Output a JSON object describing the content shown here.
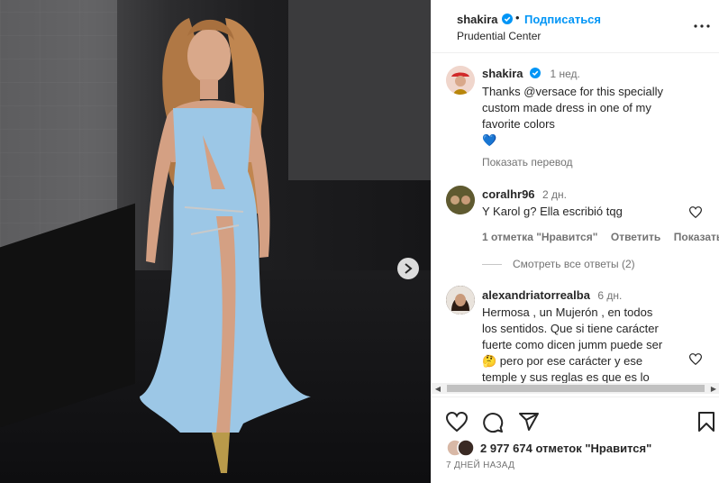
{
  "post": {
    "username": "shakira",
    "follow_label": "Подписаться",
    "dot": "•",
    "location": "Prudential Center"
  },
  "caption": {
    "username": "shakira",
    "time": "1 нед.",
    "text_line1": "Thanks @versace for this specially",
    "text_line2": "custom made dress in one of my",
    "text_line3": "favorite colors",
    "text_line4": "💙",
    "translate_label": "Показать перевод"
  },
  "comments": [
    {
      "username": "coralhr96",
      "time": "2 дн.",
      "text": "Y Karol g? Ella escribió tqg",
      "likes": "1 отметка \"Нравится\"",
      "reply": "Ответить",
      "translate": "Показать п",
      "view_replies": "Смотреть все ответы (2)"
    },
    {
      "username": "alexandriatorrealba",
      "time": "6 дн.",
      "line1": "Hermosa , un Mujerón , en todos",
      "line2": "los sentidos. Que si tiene carácter",
      "line3": "fuerte como dicen jumm puede ser",
      "line4": "🤔 pero por ese carácter y ese",
      "line5": "temple y sus reglas es que es lo"
    }
  ],
  "likes_count": "2 977 674 отметок \"Нравится\"",
  "date": "7 ДНЕЙ НАЗАД",
  "colors": {
    "accent": "#0095f6",
    "verified": "#0095f6",
    "text": "#262626",
    "muted": "#737373",
    "dress": "#9cc7e6"
  },
  "icons": [
    "verified-icon",
    "more-icon",
    "heart-icon",
    "comment-icon",
    "share-icon",
    "save-icon",
    "next-arrow-icon"
  ]
}
